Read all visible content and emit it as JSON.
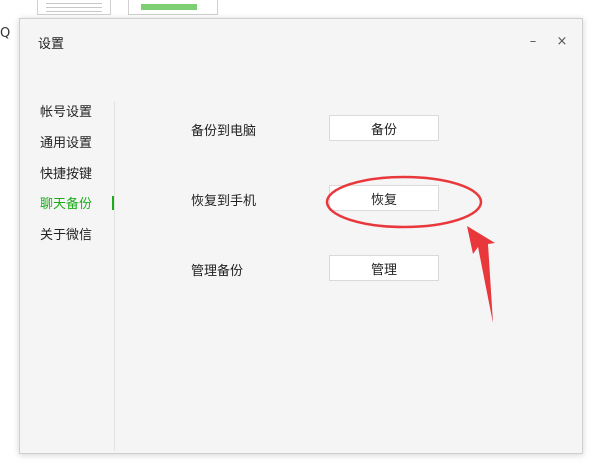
{
  "background": {
    "edge_letter": "Q"
  },
  "window": {
    "title": "设置",
    "minimize_glyph": "–",
    "close_glyph": "×"
  },
  "sidebar": {
    "items": [
      {
        "label": "帐号设置",
        "active": false
      },
      {
        "label": "通用设置",
        "active": false
      },
      {
        "label": "快捷按键",
        "active": false
      },
      {
        "label": "聊天备份",
        "active": true
      },
      {
        "label": "关于微信",
        "active": false
      }
    ]
  },
  "backup": {
    "rows": [
      {
        "label": "备份到电脑",
        "button": "备份"
      },
      {
        "label": "恢复到手机",
        "button": "恢复"
      },
      {
        "label": "管理备份",
        "button": "管理"
      }
    ]
  },
  "colors": {
    "accent": "#1aad19",
    "annotation": "#e8383c",
    "window_bg": "#f5f5f5"
  }
}
